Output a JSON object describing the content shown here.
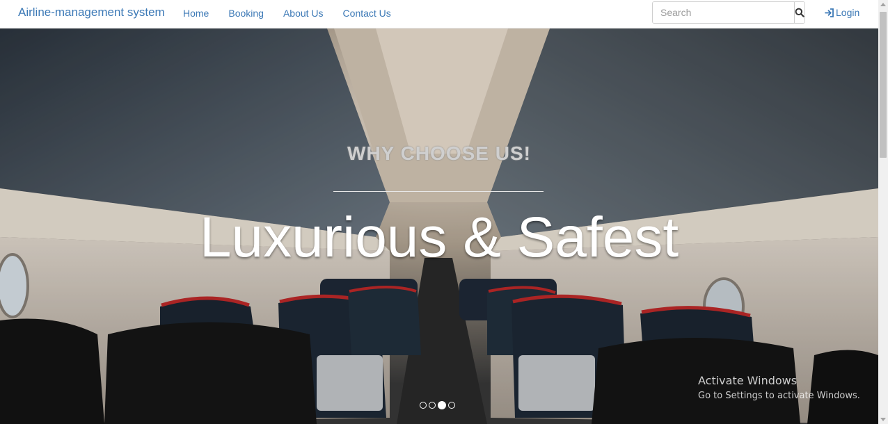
{
  "navbar": {
    "brand": "Airline-management system",
    "links": [
      "Home",
      "Booking",
      "About Us",
      "Contact Us"
    ],
    "search_placeholder": "Search",
    "search_icon": "magnifier-icon",
    "login_label": "Login",
    "login_icon": "login-arrow-icon"
  },
  "hero": {
    "kicker": "WHY CHOOSE US!",
    "headline": "Luxurious & Safest",
    "slide_count": 4,
    "active_slide": 3
  },
  "watermark": {
    "title": "Activate Windows",
    "subtitle": "Go to Settings to activate Windows."
  },
  "colors": {
    "link": "#3c79b6",
    "headline": "#ffffff"
  }
}
